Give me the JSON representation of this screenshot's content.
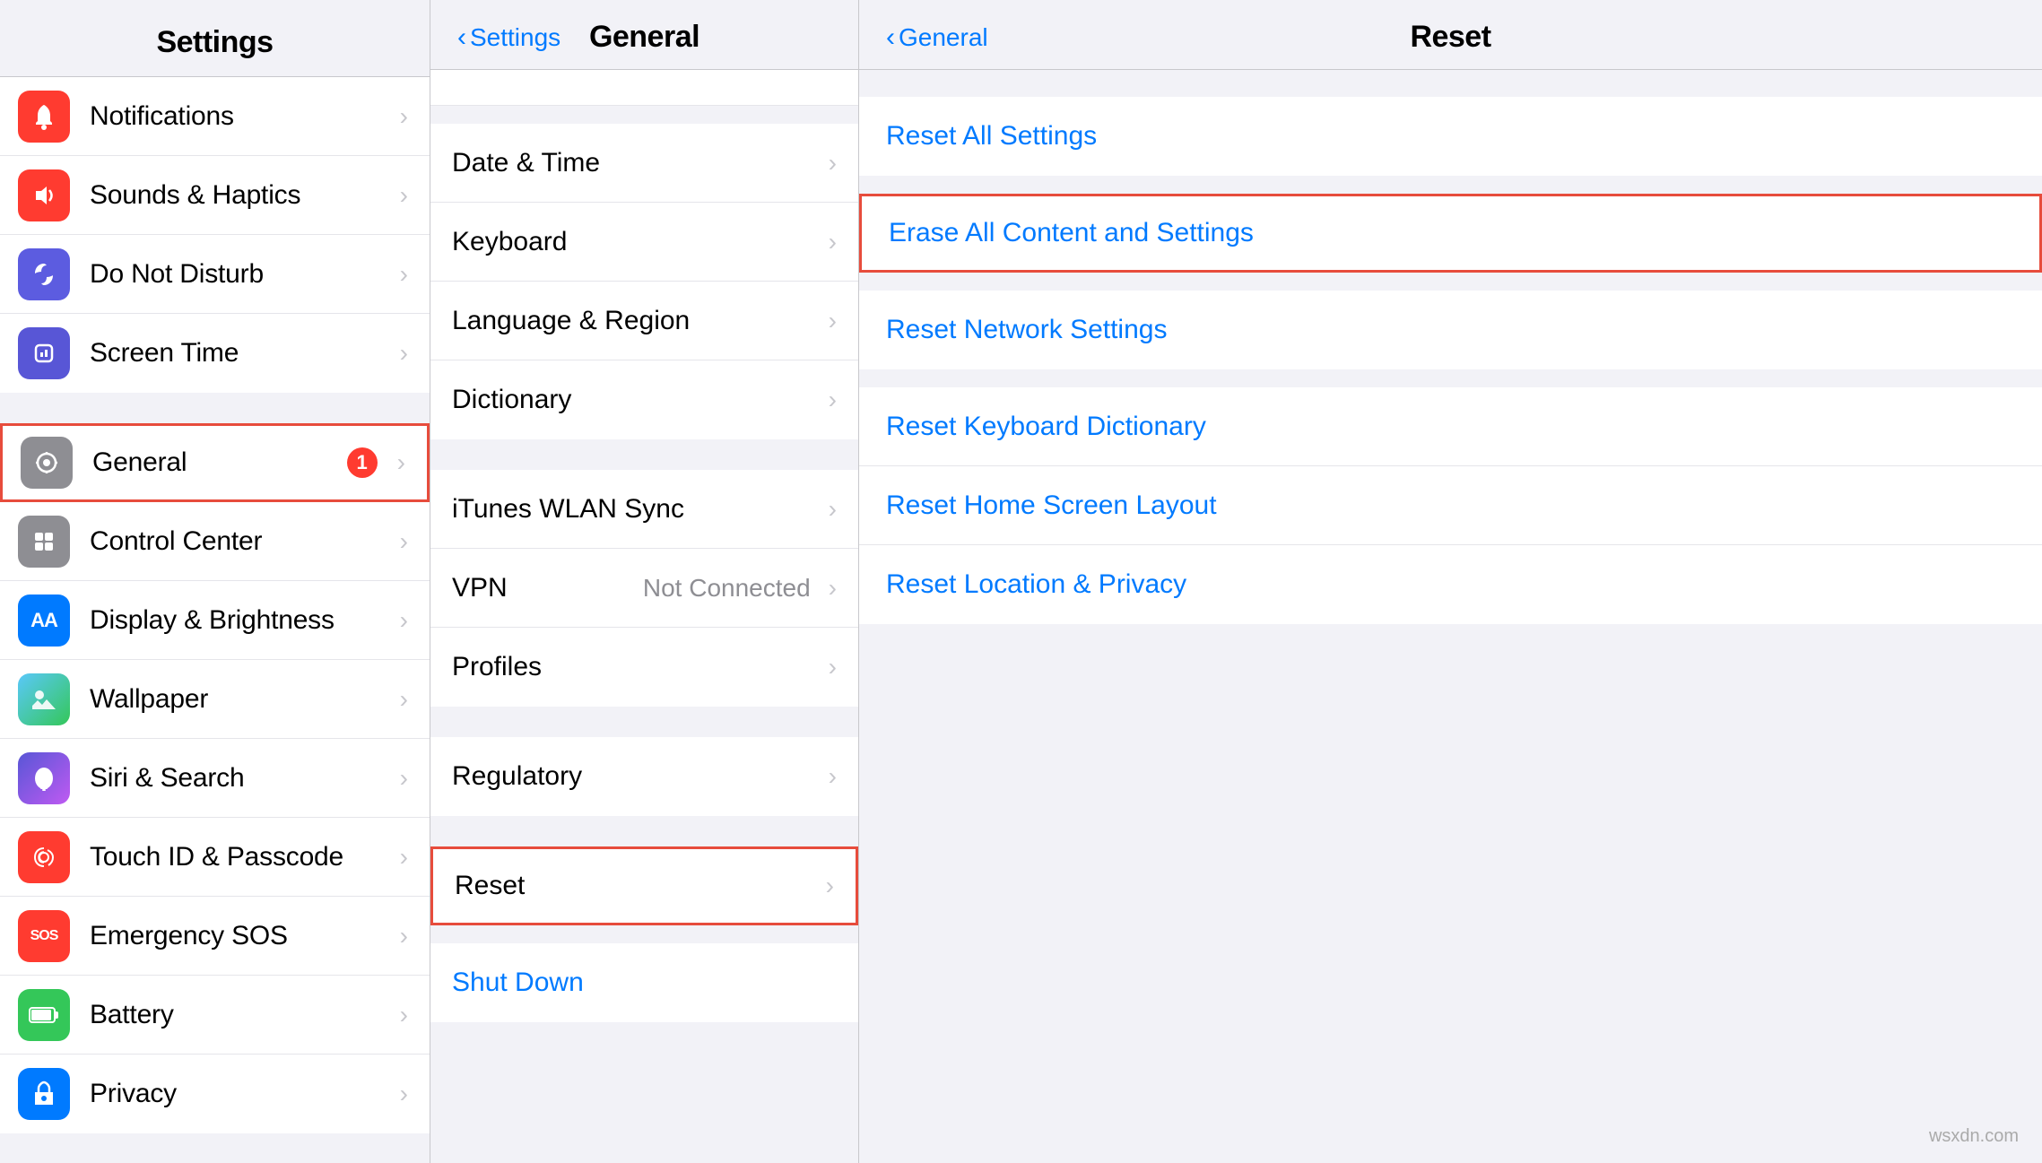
{
  "settings": {
    "title": "Settings",
    "items_group1": [
      {
        "id": "notifications",
        "label": "Notifications",
        "icon_color": "icon-red",
        "icon_char": "🔔",
        "badge": null
      },
      {
        "id": "sounds",
        "label": "Sounds & Haptics",
        "icon_color": "icon-red2",
        "icon_char": "🔊",
        "badge": null
      },
      {
        "id": "donotdisturb",
        "label": "Do Not Disturb",
        "icon_color": "icon-indigo",
        "icon_char": "🌙",
        "badge": null
      },
      {
        "id": "screentime",
        "label": "Screen Time",
        "icon_color": "icon-purple",
        "icon_char": "⏱",
        "badge": null
      }
    ],
    "items_group2": [
      {
        "id": "general",
        "label": "General",
        "icon_color": "icon-gray",
        "icon_char": "⚙️",
        "badge": "1",
        "highlighted": true
      },
      {
        "id": "controlcenter",
        "label": "Control Center",
        "icon_color": "icon-gray",
        "icon_char": "⚙",
        "badge": null
      },
      {
        "id": "displaybrightness",
        "label": "Display & Brightness",
        "icon_color": "icon-blue",
        "icon_char": "AA",
        "badge": null
      },
      {
        "id": "wallpaper",
        "label": "Wallpaper",
        "icon_color": "icon-teal",
        "icon_char": "🌸",
        "badge": null
      },
      {
        "id": "sirisearch",
        "label": "Siri & Search",
        "icon_color": "icon-purple",
        "icon_char": "✦",
        "badge": null
      },
      {
        "id": "touchid",
        "label": "Touch ID & Passcode",
        "icon_color": "icon-red",
        "icon_char": "👆",
        "badge": null
      },
      {
        "id": "emergencysos",
        "label": "Emergency SOS",
        "icon_color": "icon-red2",
        "icon_char": "SOS",
        "badge": null
      },
      {
        "id": "battery",
        "label": "Battery",
        "icon_color": "icon-green",
        "icon_char": "🔋",
        "badge": null
      },
      {
        "id": "privacy",
        "label": "Privacy",
        "icon_color": "icon-blue",
        "icon_char": "✋",
        "badge": null
      }
    ]
  },
  "general": {
    "back_label": "Settings",
    "title": "General",
    "items_group1": [
      {
        "id": "datetime",
        "label": "Date & Time",
        "value": null
      },
      {
        "id": "keyboard",
        "label": "Keyboard",
        "value": null
      },
      {
        "id": "languageregion",
        "label": "Language & Region",
        "value": null
      },
      {
        "id": "dictionary",
        "label": "Dictionary",
        "value": null
      }
    ],
    "items_group2": [
      {
        "id": "ituneswlan",
        "label": "iTunes WLAN Sync",
        "value": null
      },
      {
        "id": "vpn",
        "label": "VPN",
        "value": "Not Connected"
      },
      {
        "id": "profiles",
        "label": "Profiles",
        "value": null
      }
    ],
    "items_group3": [
      {
        "id": "regulatory",
        "label": "Regulatory",
        "value": null
      }
    ],
    "items_group4": [
      {
        "id": "reset",
        "label": "Reset",
        "value": null,
        "highlighted": true
      }
    ],
    "shutdown_label": "Shut Down"
  },
  "reset": {
    "back_label": "General",
    "title": "Reset",
    "items": [
      {
        "id": "reset-all-settings",
        "label": "Reset All Settings",
        "highlighted": false
      },
      {
        "id": "erase-all",
        "label": "Erase All Content and Settings",
        "highlighted": true
      },
      {
        "id": "reset-network",
        "label": "Reset Network Settings",
        "highlighted": false
      },
      {
        "id": "reset-keyboard",
        "label": "Reset Keyboard Dictionary",
        "highlighted": false
      },
      {
        "id": "reset-home",
        "label": "Reset Home Screen Layout",
        "highlighted": false
      },
      {
        "id": "reset-location",
        "label": "Reset Location & Privacy",
        "highlighted": false
      }
    ]
  },
  "watermark": "wsxdn.com"
}
